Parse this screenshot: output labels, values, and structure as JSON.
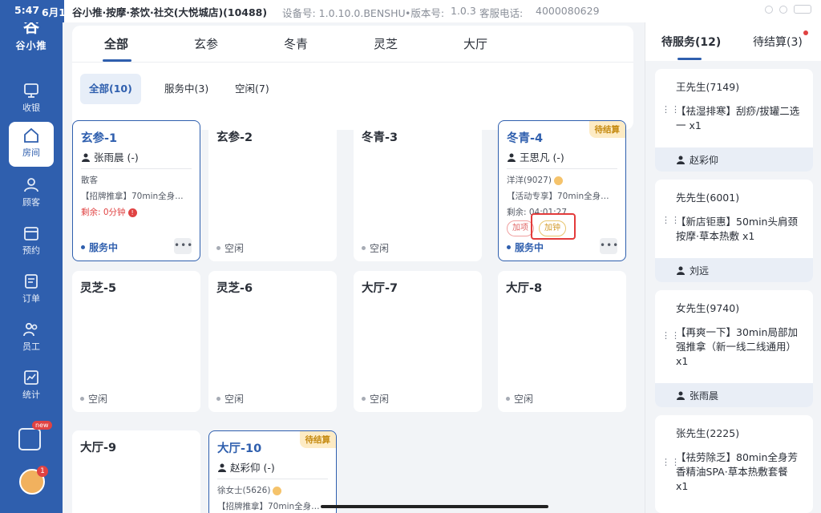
{
  "statusbar": {
    "time": "5:47",
    "date": "6月1",
    "store": "谷小推·按摩·茶饮·社交(大悦城店)(10488)",
    "device_label": "设备号: 1.0.10.0.BENSHU",
    "version_label": "•版本号:",
    "version_value": "1.0.3",
    "service_label": "客服电话:",
    "service_phone": "4000080629"
  },
  "logo": {
    "mark": "谷",
    "name": "谷小推"
  },
  "nav": [
    {
      "label": "收银",
      "icon": "cashier-icon"
    },
    {
      "label": "房间",
      "icon": "home-icon",
      "active": true
    },
    {
      "label": "顾客",
      "icon": "customer-icon"
    },
    {
      "label": "预约",
      "icon": "calendar-icon"
    },
    {
      "label": "订单",
      "icon": "order-icon"
    },
    {
      "label": "员工",
      "icon": "staff-icon"
    },
    {
      "label": "统计",
      "icon": "chart-icon"
    }
  ],
  "promo": {
    "label": "new",
    "text": "推"
  },
  "avatar": {
    "badge": "1"
  },
  "tabs": [
    "全部",
    "玄参",
    "冬青",
    "灵芝",
    "大厅"
  ],
  "filters": [
    "全部(10)",
    "服务中(3)",
    "空闲(7)"
  ],
  "rooms": [
    {
      "title": "玄参-1",
      "staff": "张雨晨 (-)",
      "l1": "散客",
      "l2": "【招牌推拿】70min全身…",
      "l3": "剩余: 0分钟",
      "status": "服务中"
    },
    {
      "title": "玄参-2",
      "status": "空闲"
    },
    {
      "title": "冬青-3",
      "status": "空闲"
    },
    {
      "title": "冬青-4",
      "pending": "待结算",
      "staff": "王思凡 (-)",
      "l1": "洋洋(9027)",
      "l2": "【活动专享】70min全身…",
      "l3": "剩余: 04:01:27",
      "tag_add_item": "加项",
      "tag_add_time": "加钟",
      "status": "服务中"
    },
    {
      "title": "灵芝-5",
      "status": "空闲"
    },
    {
      "title": "灵芝-6",
      "status": "空闲"
    },
    {
      "title": "大厅-7",
      "status": "空闲"
    },
    {
      "title": "大厅-8",
      "status": "空闲"
    },
    {
      "title": "大厅-9"
    },
    {
      "title": "大厅-10",
      "pending": "待结算",
      "staff": "赵彩仰 (-)",
      "l1": "徐女士(5626)",
      "l2": "【招牌推拿】70min全身…"
    }
  ],
  "right": {
    "tab_waiting": "待服务(12)",
    "tab_settle": "待结算(3)",
    "orders": [
      {
        "cust": "王先生(7149)",
        "desc": "【祛湿排寒】刮痧/拔罐二选一 x1",
        "staff": "赵彩仰"
      },
      {
        "cust": "先先生(6001)",
        "desc": "【新店钜惠】50min头肩颈按摩·草本热敷 x1",
        "staff": "刘远"
      },
      {
        "cust": "女先生(9740)",
        "desc": "【再爽一下】30min局部加强推拿（新一线二线通用）x1",
        "staff": "张雨晨"
      },
      {
        "cust": "张先生(2225)",
        "desc": "【祛劳除乏】80min全身芳香精油SPA·草本热敷套餐 x1"
      }
    ]
  }
}
